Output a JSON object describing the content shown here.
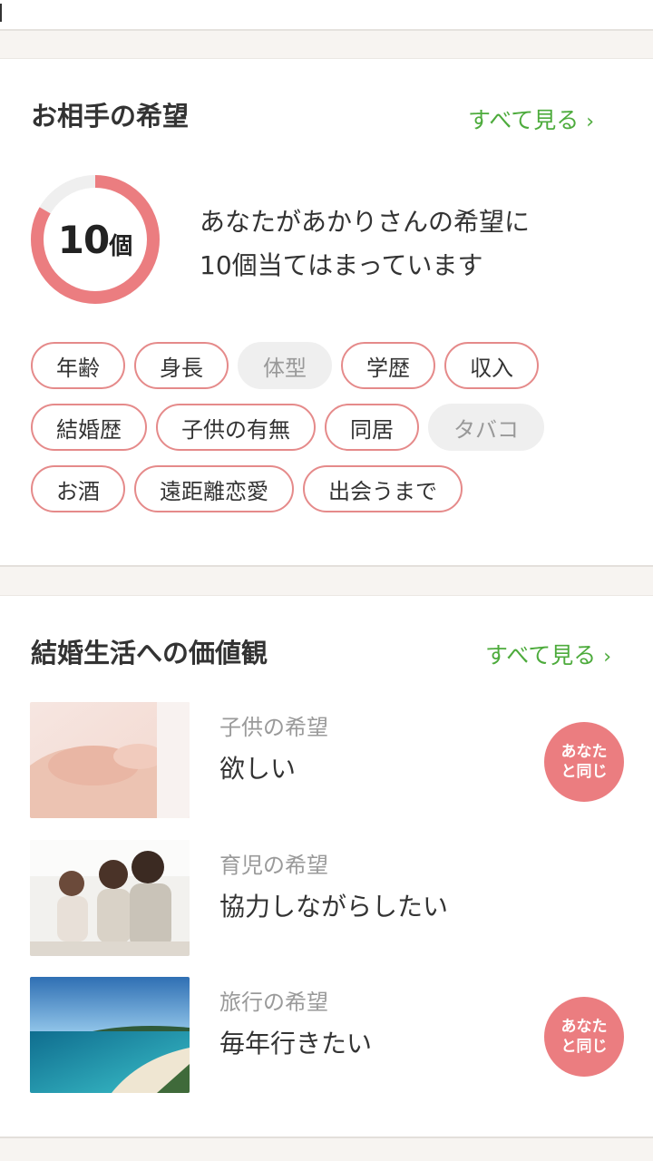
{
  "partner_wishes": {
    "title": "お相手の希望",
    "see_all": "すべて見る",
    "match_count": 10,
    "match_count_num": "10",
    "match_count_unit": "個",
    "match_total": 12,
    "description_line1": "あなたがあかりさんの希望に",
    "description_line2": "10個当てはまっています",
    "chip_rows": [
      [
        {
          "label": "年齢",
          "matched": true
        },
        {
          "label": "身長",
          "matched": true
        },
        {
          "label": "体型",
          "matched": false
        },
        {
          "label": "学歴",
          "matched": true
        },
        {
          "label": "収入",
          "matched": true
        }
      ],
      [
        {
          "label": "結婚歴",
          "matched": true
        },
        {
          "label": "子供の有無",
          "matched": true
        },
        {
          "label": "同居",
          "matched": true
        },
        {
          "label": "タバコ",
          "matched": false
        }
      ],
      [
        {
          "label": "お酒",
          "matched": true
        },
        {
          "label": "遠距離恋愛",
          "matched": true
        },
        {
          "label": "出会うまで",
          "matched": true
        }
      ]
    ]
  },
  "marriage_values": {
    "title": "結婚生活への価値観",
    "see_all": "すべて見る",
    "items": [
      {
        "category": "子供の希望",
        "value": "欲しい",
        "same": true,
        "badge_line1": "あなた",
        "badge_line2": "と同じ",
        "image": "baby-hand-photo"
      },
      {
        "category": "育児の希望",
        "value": "協力しながらしたい",
        "same": false,
        "image": "family-photo"
      },
      {
        "category": "旅行の希望",
        "value": "毎年行きたい",
        "same": true,
        "badge_line1": "あなた",
        "badge_line2": "と同じ",
        "image": "beach-photo"
      }
    ]
  },
  "colors": {
    "accent_pink": "#eb7d80",
    "chip_border": "#e58a8a",
    "link_green": "#4dab3c",
    "inactive_gray": "#efefef"
  },
  "icons": {
    "see_all_chevron": "chevron-right-icon"
  }
}
